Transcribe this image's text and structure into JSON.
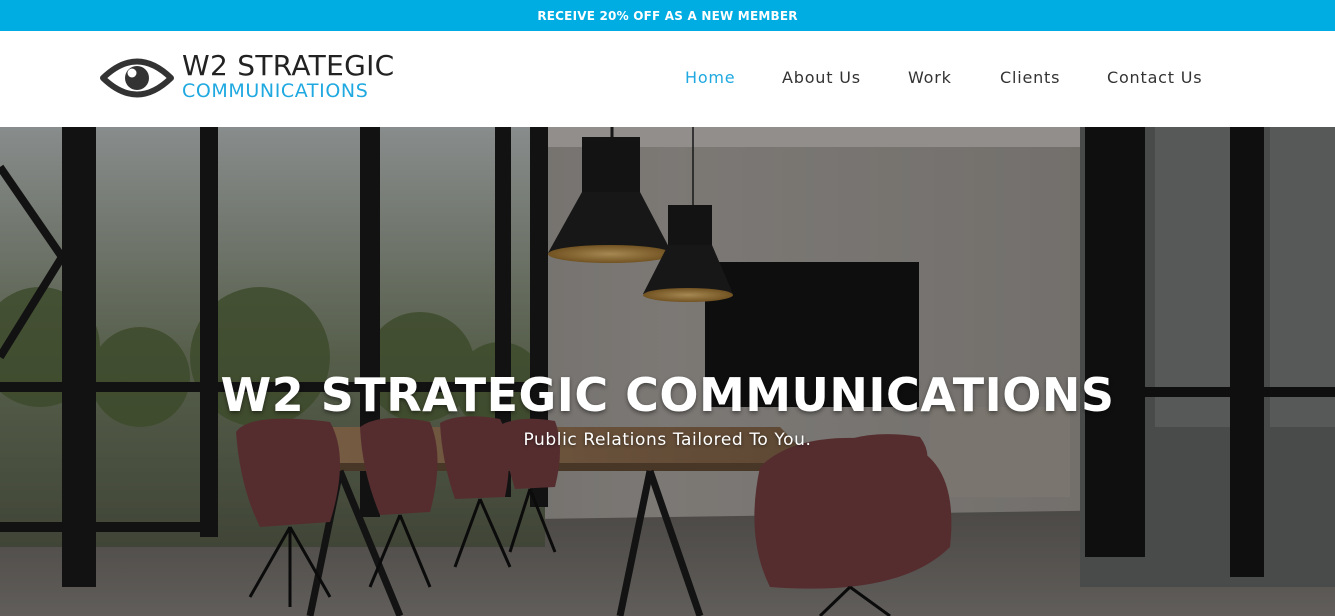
{
  "promo": {
    "text": "RECEIVE 20% OFF AS A NEW MEMBER"
  },
  "logo": {
    "line1": "W2 STRATEGIC",
    "line2": "COMMUNICATIONS",
    "icon": "eye-icon"
  },
  "nav": {
    "items": [
      {
        "label": "Home",
        "active": true
      },
      {
        "label": "About Us",
        "active": false
      },
      {
        "label": "Work",
        "active": false
      },
      {
        "label": "Clients",
        "active": false
      },
      {
        "label": "Contact Us",
        "active": false
      }
    ]
  },
  "hero": {
    "title": "W2 STRATEGIC COMMUNICATIONS",
    "subtitle": "Public Relations Tailored To You."
  },
  "colors": {
    "accent": "#00ade3",
    "nav_active": "#1fa9e0",
    "text_dark": "#333333"
  }
}
